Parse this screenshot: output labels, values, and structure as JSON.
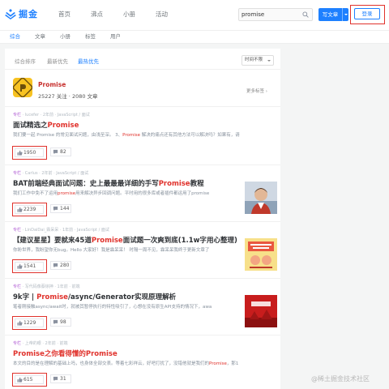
{
  "header": {
    "logo_text": "掘金",
    "nav": [
      "首页",
      "沸点",
      "小册",
      "活动"
    ],
    "search_value": "promise",
    "write_label": "写文章",
    "login_label": "登录"
  },
  "subnav": {
    "items": [
      "综合",
      "文章",
      "小册",
      "标签",
      "用户"
    ],
    "active_index": 0
  },
  "sort": {
    "items": [
      "综合排序",
      "最新优先",
      "最热优先"
    ],
    "active_index": 2,
    "time_filter": "时间不限"
  },
  "tag": {
    "name": "Promise",
    "stats": "25227 关注 · 2080 文章",
    "more": "更多标签 ›"
  },
  "articles": [
    {
      "tag": "专栏",
      "meta": " · lucefer · 2年前 · JavaScript / 面试",
      "title_pre": "面试精选之",
      "title_hl": "Promise",
      "title_post": "",
      "desc_pre": "我们要一起 Promise 的常见面试问题，由浅至深。 3、",
      "desc_hl": "Promise",
      "desc_post": " 解决的痛点还有其他方法可以解决吗？如果有，请",
      "likes": "1950",
      "comments": "82",
      "has_image": false
    },
    {
      "tag": "专栏",
      "meta": " · Carlus · 2年前 · JavaScript / 面试",
      "title_pre": "BAT前端经典面试问题：史上最最最详细的手写",
      "title_hl": "Promise",
      "title_post": "教程",
      "desc_pre": "我们工作中免不了运用",
      "desc_hl": "promise",
      "desc_post": "用来解决异步回调问题。平时用的很多库或者插件都运用了promise",
      "likes": "2239",
      "comments": "144",
      "has_image": true,
      "image_kind": "portrait"
    },
    {
      "tag": "专栏",
      "meta": " · LinDaiDai_霖呆呆 · 1年前 · JavaScript / 面试",
      "title_pre": "【建议星星】要就来45道",
      "title_hl": "Promise",
      "title_post": "面试题一次爽到底(1.1w字用心整理)",
      "desc_pre": "你盼世界，我盼望你无bug。Hello 大家好！我是霖呆呆！ 时隔一周不见，霖呆呆我终于更新文章了",
      "desc_hl": "",
      "desc_post": "",
      "likes": "1541",
      "comments": "280",
      "has_image": true,
      "image_kind": "poster"
    },
    {
      "tag": "专栏",
      "meta": " · 写代码像蔡徐抻 · 1年前 · 前端",
      "title_pre": "9k字 | ",
      "title_hl": "Promise",
      "title_post": "/async/Generator实现原理解析",
      "desc_pre": "笔者刚接触async/await时，就被其暂停执行的特性吸引了，心想在没有原生API支持的情况下，awa",
      "desc_hl": "",
      "desc_post": "",
      "likes": "1229",
      "comments": "98",
      "has_image": true,
      "image_kind": "promise-red"
    },
    {
      "tag": "专栏",
      "meta": " · 上帝的眼 · 2年前 · 前端",
      "title_pre": "",
      "title_hl": "Promise",
      "title_post": "之你看得懂的Promise",
      "desc_pre": "本文的目的是在理解的基础上吗，也身体全部交表。等着七彩祥云，好吧打扰了，没错他就是我们的",
      "desc_hl": "Promise",
      "desc_post": "，那1",
      "likes": "615",
      "comments": "31",
      "has_image": false
    }
  ],
  "watermark": "@稀土掘金技术社区",
  "colors": {
    "brand_blue": "#1e80ff",
    "highlight_red": "#e0322c",
    "tag_purple": "#b25fd5"
  }
}
